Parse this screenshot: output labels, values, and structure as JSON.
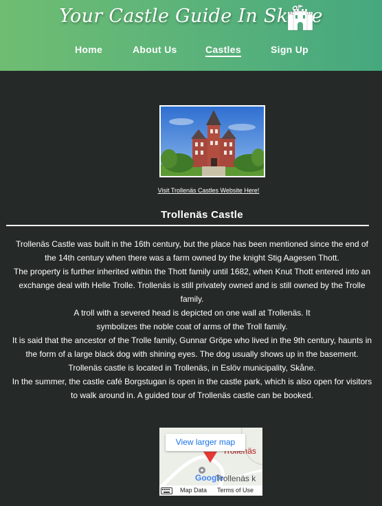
{
  "header": {
    "site_title": "Your Castle Guide In Skåne",
    "logo_icon": "castle-icon"
  },
  "nav": {
    "items": [
      {
        "label": "Home"
      },
      {
        "label": "About Us"
      },
      {
        "label": "Castles",
        "active": true
      },
      {
        "label": "Sign Up"
      }
    ]
  },
  "castle": {
    "website_link": "Visit Trollenäs Castles Website Here!",
    "title": "Trollenäs Castle",
    "paragraphs": [
      "Trollenäs Castle was built in the 16th century, but the place has been mentioned since the end of the 14th century when there was a farm owned by the knight Stig Aagesen Thott.",
      "The property is further inherited within the Thott family until 1682, when Knut Thott entered into an exchange deal with Helle Trolle. Trollenäs is still privately owned and is still owned by the Trolle family.",
      "A troll with a severed head is depicted on one wall at Trollenäs. It symbolizes the noble coat of arms of the Troll family.",
      "It is said that the ancestor of the Trolle family, Gunnar Gröpe who lived in the 9th century, haunts in the form of a large black dog with shining eyes. The dog usually shows up in the basement.",
      "Trollenäs castle is located in Trollenäs, in Eslöv municipality, Skåne.",
      "In the summer, the castle café Borgstugan is open in the castle park, which is also open for visitors to walk around in. A guided tour of Trollenäs castle can be booked."
    ]
  },
  "map": {
    "view_larger_label": "View larger map",
    "place_label_top": "Trollenäs",
    "place_label_bottom": "Trollenäs k",
    "provider_logo": "Google",
    "map_data_label": "Map Data",
    "terms_label": "Terms of Use"
  },
  "colors": {
    "page_bg": "#252a28",
    "header_gradient_start": "#6fbd72",
    "header_gradient_end": "#46a87e",
    "map_link": "#1a73e8"
  }
}
